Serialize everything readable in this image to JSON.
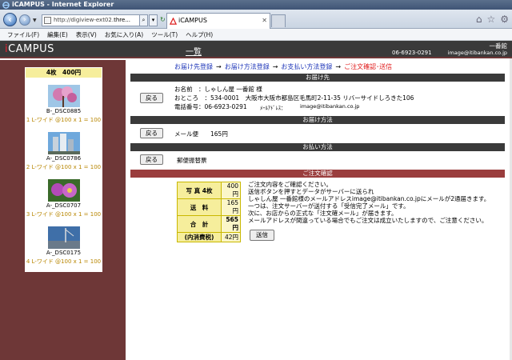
{
  "window": {
    "title": "iCAMPUS - Internet Explorer"
  },
  "browser": {
    "address_url_prefix": "http://digiview-ext02.",
    "address_url_domain": "thre...",
    "tab_title": "iCAMPUS"
  },
  "menu": [
    "ファイル(F)",
    "編集(E)",
    "表示(V)",
    "お気に入り(A)",
    "ツール(T)",
    "ヘルプ(H)"
  ],
  "header": {
    "logo_prefix": "i",
    "logo_rest": "CAMPUS",
    "title": "一覧",
    "shop_name": "一番館",
    "phone": "06-6923-0291",
    "email": "image@itibankan.co.jp"
  },
  "cart": {
    "summary": "4枚　400円",
    "items": [
      {
        "file": "B-_DSC0885",
        "spec": "1 L-ワイド @100 x 1 = 100"
      },
      {
        "file": "A-_DSC0786",
        "spec": "2 L-ワイド @100 x 1 = 100"
      },
      {
        "file": "A-_DSC0707",
        "spec": "3 L-ワイド @100 x 1 = 100"
      },
      {
        "file": "A-_DSC0175",
        "spec": "4 L-ワイド @100 x 1 = 100"
      }
    ]
  },
  "steps": {
    "s1": "お届け先登録",
    "s2": "お届け方法登録",
    "s3": "お支払い方法登録",
    "s4": "ご注文確認･送信",
    "arrow": "→"
  },
  "sections": {
    "delivery_to": "お届け先",
    "delivery_method": "お届け方法",
    "payment": "お払い方法",
    "confirm": "ご注文確認"
  },
  "buttons": {
    "back": "戻る",
    "send": "送信"
  },
  "delivery": {
    "name_line": "お名前　：しゃしん屋 一番館 様",
    "address_line": "おところ　：534-0001　大阪市大阪市都島区毛馬町2-11-35 リバーサイドしろきた106",
    "phone_line": "電話番号：06-6923-0291",
    "mail_label": "ﾒｰﾙｱﾄﾞﾚｽ：",
    "mail_value": "image@itibankan.co.jp"
  },
  "method": {
    "text": "メール便　　165円"
  },
  "payment": {
    "text": "郵便振替票"
  },
  "summary": [
    {
      "label": "写 真 4枚",
      "value": "400円"
    },
    {
      "label": "送　料",
      "value": "165円"
    },
    {
      "label": "合　計",
      "value": "565円"
    },
    {
      "label": "(内消費税)",
      "value": "42円"
    }
  ],
  "messages": [
    "ご注文内容をご確認ください。",
    "送信ボタンを押すとデータがサーバーに送られ",
    "しゃしん屋 一番館様のメールアドレスimage@itibankan.co.jpにメールが2通届きます。",
    "一つは、注文サーバーが送付する「受信完了メール」です。",
    "次に、お店からの正式な「注文確メール」が届きます。",
    "メールアドレスが間違っている場合でもご注文は成立いたしますので、ご注意ください。"
  ],
  "colors": {
    "sidebar": "#6e3737",
    "header": "#3a3a3a",
    "confirm_bar": "#9a3d3d",
    "step_link": "#1d35b8",
    "step_current": "#e01919",
    "cart_head": "#f6ee9c",
    "spec_text": "#b88600"
  }
}
